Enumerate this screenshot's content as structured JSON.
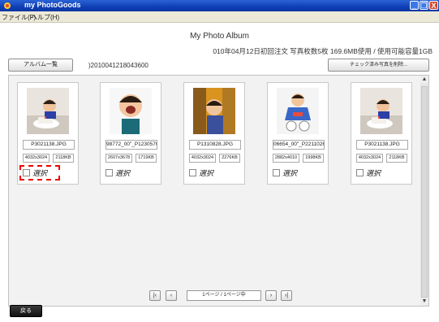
{
  "window": {
    "title": "my PhotoGoods",
    "btn_min": "_",
    "btn_max": "❐",
    "btn_close": "X"
  },
  "menu": {
    "file": "ファイル(F)",
    "help": "ヘルプ(H)"
  },
  "header": {
    "album_title": "My Photo Album",
    "order_info": "010年04月12日初回注文 写真枚数5枚 169.6MB使用 / 使用可能容量1GB",
    "album_list_button": "アルバム一覧",
    "album_path": ")2010041218043600",
    "delete_checked_button": "チェック済み写真を削除..."
  },
  "photos": [
    {
      "filename": "P3021138.JPG",
      "dimensions": "4032x3024",
      "size": "2118KB",
      "select_label": "選択"
    },
    {
      "filename": "98772_00\"_P1230570.JP",
      "dimensions": "2607x3678",
      "size": "1719KB",
      "select_label": "選択"
    },
    {
      "filename": "P1310828.JPG",
      "dimensions": "4032x3024",
      "size": "2276KB",
      "select_label": "選択"
    },
    {
      "filename": "06654_00\"_P2211026.JF",
      "dimensions": "2882x4010",
      "size": "1998KB",
      "select_label": "選択"
    },
    {
      "filename": "P3021138.JPG",
      "dimensions": "4032x3024",
      "size": "2118KB",
      "select_label": "選択"
    }
  ],
  "pager": {
    "first": "|‹",
    "prev": "‹",
    "page_label": "1ページ / 1ページ中",
    "next": "›",
    "last": "›|"
  },
  "footer": {
    "back_button": "戻る"
  },
  "colors": {
    "titlebar": "#0f3fb4",
    "highlight": "#e00000"
  }
}
